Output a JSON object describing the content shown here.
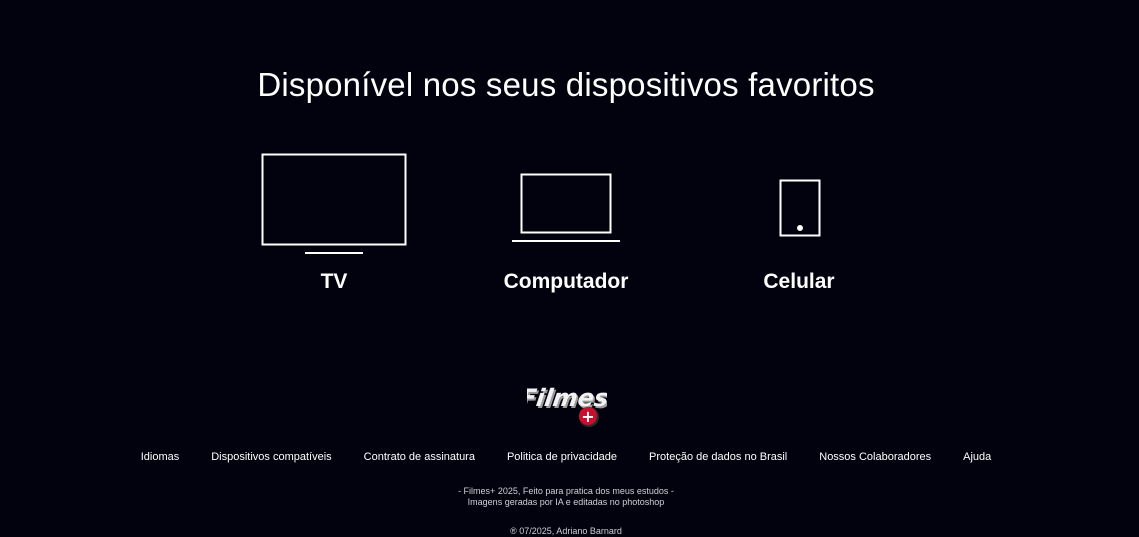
{
  "devices_section": {
    "title": "Disponível nos seus dispositivos favoritos",
    "devices": [
      {
        "label": "TV",
        "icon": "tv-icon"
      },
      {
        "label": "Computador",
        "icon": "laptop-icon"
      },
      {
        "label": "Celular",
        "icon": "smartphone-icon"
      }
    ]
  },
  "footer": {
    "logo": {
      "text": "Filmes",
      "badge": "+",
      "badge_color": "#c8102e"
    },
    "links": [
      "Idiomas",
      "Dispositivos compatíveis",
      "Contrato de assinatura",
      "Politica de privacidade",
      "Proteção de dados no Brasil",
      "Nossos Colaboradores",
      "Ajuda"
    ],
    "note_line1": "- Filmes+ 2025, Feito para pratica dos meus estudos -",
    "note_line2": "Imagens geradas por IA e editadas no photoshop",
    "copyright": "® 07/2025, Adriano Barnard"
  },
  "colors": {
    "background": "#02020f",
    "text": "#ffffff",
    "muted_text": "#d0d0d8",
    "accent": "#c8102e"
  }
}
